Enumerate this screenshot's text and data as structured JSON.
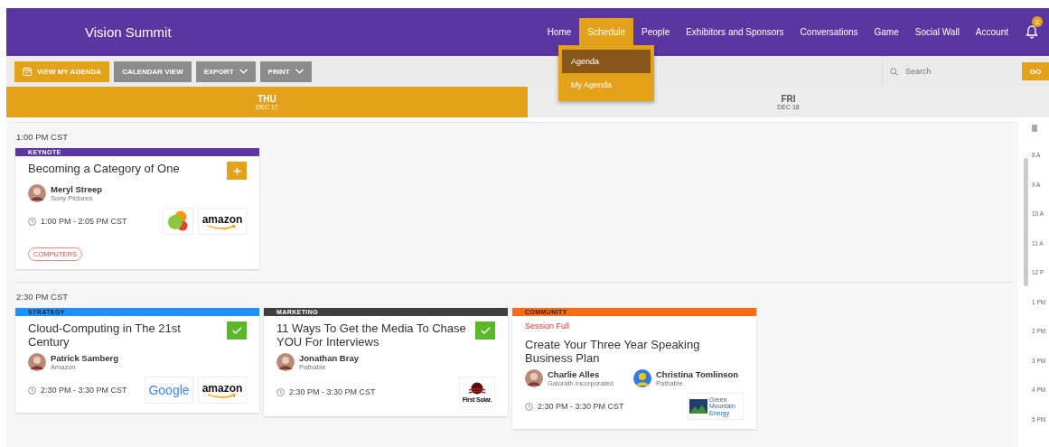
{
  "header": {
    "title": "Vision Summit",
    "notification_count": "2",
    "nav": [
      {
        "label": "Home",
        "selected": false
      },
      {
        "label": "Schedule",
        "selected": true
      },
      {
        "label": "People",
        "selected": false
      },
      {
        "label": "Exhibitors and Sponsors",
        "selected": false
      },
      {
        "label": "Conversations",
        "selected": false
      },
      {
        "label": "Game",
        "selected": false
      },
      {
        "label": "Social Wall",
        "selected": false
      },
      {
        "label": "Account",
        "selected": false
      }
    ]
  },
  "nav_menu": {
    "items": [
      {
        "label": "Agenda",
        "selected": true
      },
      {
        "label": "My Agenda",
        "selected": false
      }
    ]
  },
  "toolbar": {
    "buttons": [
      {
        "label": "VIEW MY AGENDA",
        "kind": "primary"
      },
      {
        "label": "CALENDAR VIEW",
        "kind": "plain"
      },
      {
        "label": "EXPORT",
        "kind": "dropdown"
      },
      {
        "label": "PRINT",
        "kind": "dropdown"
      }
    ],
    "search": {
      "placeholder": "Search"
    },
    "go": "GO"
  },
  "days": [
    {
      "day": "THU",
      "date": "DEC 17",
      "selected": true
    },
    {
      "day": "FRI",
      "date": "DEC 18",
      "selected": false
    }
  ],
  "slots": [
    {
      "time": "1:00 PM CST",
      "sessions": [
        {
          "track": "KEYNOTE",
          "color": "#5b35a0",
          "title": "Becoming a Category of One",
          "in_agenda": false,
          "speakers": [
            {
              "name": "Meryl Streep",
              "org": "Sony Pictures"
            }
          ],
          "time": "1:00 PM - 2:05 PM CST",
          "sponsors": [
            {
              "kind": "circles"
            },
            {
              "kind": "amazon",
              "name": "amazon"
            }
          ],
          "tags": [
            "COMPUTERS"
          ]
        }
      ]
    },
    {
      "time": "2:30 PM CST",
      "sessions": [
        {
          "track": "STRATEGY",
          "color": "#1e90ff",
          "title": "Cloud-Computing in The 21st Century",
          "in_agenda": true,
          "speakers": [
            {
              "name": "Patrick Samberg",
              "org": "Amazon"
            }
          ],
          "time": "2:30 PM - 3:30 PM CST",
          "sponsors": [
            {
              "kind": "google",
              "name": "Google"
            },
            {
              "kind": "amazon",
              "name": "amazon"
            }
          ]
        },
        {
          "track": "MARKETING",
          "color": "#3f3f3f",
          "title": "11 Ways To Get the Media To Chase YOU For Interviews",
          "in_agenda": true,
          "speakers": [
            {
              "name": "Jonathan Bray",
              "org": "Pathable"
            }
          ],
          "time": "2:30 PM - 3:30 PM CST",
          "sponsors": [
            {
              "kind": "solar",
              "name": "First Solar."
            }
          ]
        },
        {
          "track": "COMMUNITY",
          "color": "#ff6a13",
          "notice": "Session Full",
          "title": "Create Your Three Year Speaking Business Plan",
          "speakers": [
            {
              "name": "Charlie Alles",
              "org": "Galorath Incorporated"
            },
            {
              "name": "Christina Tomlinson",
              "org": "Pathable"
            }
          ],
          "time": "2:30 PM - 3:30 PM CST",
          "sponsors": [
            {
              "kind": "mountain",
              "name": "Green Mountain Energy"
            }
          ]
        }
      ]
    }
  ],
  "ruler": [
    "8 A",
    "9 A",
    "10 A",
    "11 A",
    "12 P",
    "1 PM",
    "2 PM",
    "3 PM",
    "4 PM",
    "5 PM"
  ]
}
